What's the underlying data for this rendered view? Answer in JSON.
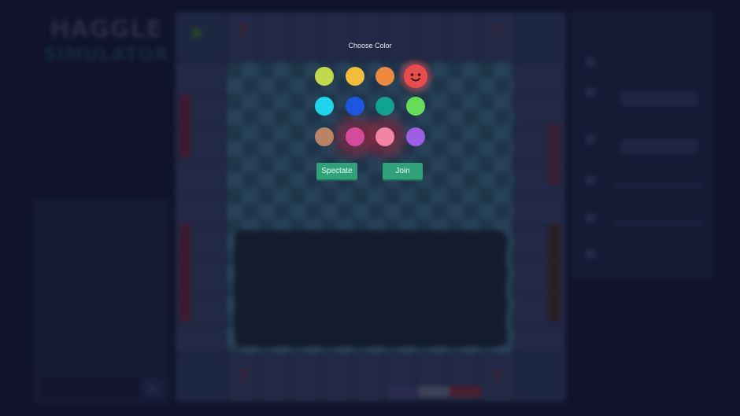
{
  "app": {
    "logo_line1": "HAGGLE",
    "logo_line2": "SIMULATOR"
  },
  "modal": {
    "title": "Choose Color",
    "colors": [
      {
        "name": "yellow-green",
        "hex": "#c3d94c"
      },
      {
        "name": "amber",
        "hex": "#f2bd39"
      },
      {
        "name": "orange",
        "hex": "#ee8a3c"
      },
      {
        "name": "red",
        "hex": "#e84c4c",
        "selected": true
      },
      {
        "name": "cyan",
        "hex": "#1ed6ec"
      },
      {
        "name": "blue",
        "hex": "#1b57e0"
      },
      {
        "name": "teal",
        "hex": "#11a392"
      },
      {
        "name": "green",
        "hex": "#66dd57"
      },
      {
        "name": "brown",
        "hex": "#bc8266"
      },
      {
        "name": "magenta",
        "hex": "#d64a9b",
        "taken": true
      },
      {
        "name": "pink",
        "hex": "#f285a3",
        "taken": true
      },
      {
        "name": "purple",
        "hex": "#9c5ee2"
      }
    ],
    "spectate_label": "Spectate",
    "join_label": "Join"
  },
  "accent": {
    "button": "#2fa27a"
  }
}
